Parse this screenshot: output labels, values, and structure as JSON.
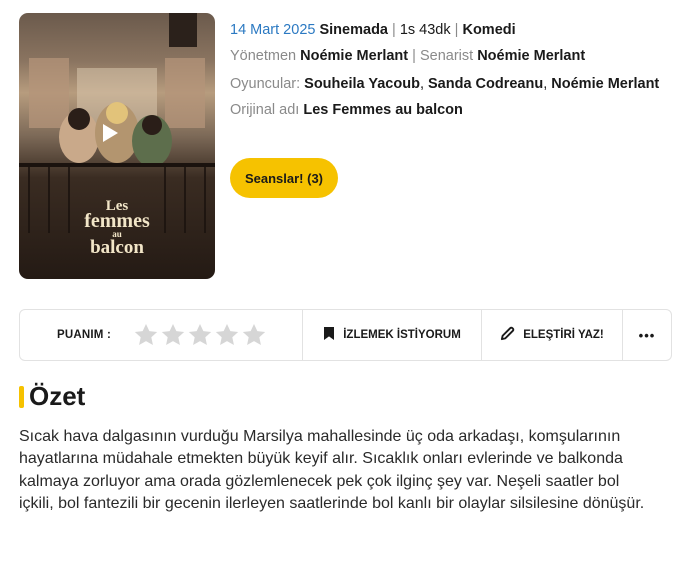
{
  "poster": {
    "title_line1": "Les",
    "title_line2": "femmes",
    "title_line3": "au",
    "title_line4": "balcon",
    "play_icon": "play-icon"
  },
  "meta": {
    "date": "14 Mart 2025",
    "status": "Sinemada",
    "duration": "1s 43dk",
    "genre": "Komedi",
    "director_label": "Yönetmen",
    "director": "Noémie Merlant",
    "writer_label": "Senarist",
    "writer": "Noémie Merlant",
    "cast_label": "Oyuncular:",
    "cast": [
      "Souheila Yacoub",
      "Sanda Codreanu",
      "Noémie Merlant"
    ],
    "original_label": "Orijinal adı",
    "original_title": "Les Femmes au balcon"
  },
  "seans_button": "Seanslar! (3)",
  "actions": {
    "rating_label": "PUANIM :",
    "stars": 5,
    "watchlist_label": "İZLEMEK İSTİYORUM",
    "critic_label": "ELEŞTİRİ YAZ!",
    "more_label": "•••"
  },
  "summary": {
    "title": "Özet",
    "text": "Sıcak hava dalgasının vurduğu Marsilya mahallesinde üç oda arkadaşı, komşularının hayatlarına müdahale etmekten büyük keyif alır. Sıcaklık onları evlerinde ve balkonda kalmaya zorluyor ama orada gözlemlenecek pek çok ilginç şey var. Neşeli saatler bol içkili, bol fantezili bir gecenin ilerleyen saatlerinde bol kanlı bir olaylar silsilesine dönüşür."
  },
  "colors": {
    "accent": "#f6c200",
    "date": "#2b79c2",
    "muted": "#8a8a8a",
    "star_empty": "#d6d6d6"
  }
}
